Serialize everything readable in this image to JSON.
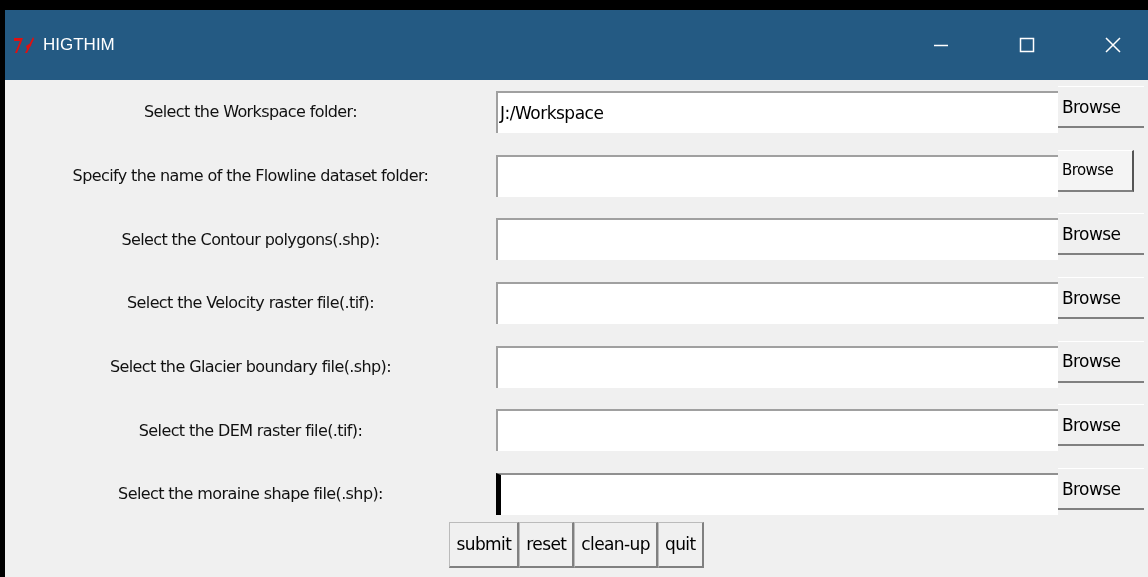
{
  "window": {
    "title": "HIGTHIM"
  },
  "rows": [
    {
      "label": "Select the Workspace folder:",
      "value": "J:/Workspace",
      "focused": false,
      "button": {
        "label": "Browse",
        "focused": false
      }
    },
    {
      "label": "Specify the name of the Flowline dataset folder:",
      "focused": false,
      "button": {
        "label": "Browse",
        "focused": true
      }
    },
    {
      "label": "Select the Contour polygons(.shp):",
      "focused": false,
      "button": {
        "label": "Browse",
        "focused": false
      }
    },
    {
      "label": "Select the Velocity raster file(.tif):",
      "focused": false,
      "button": {
        "label": "Browse",
        "focused": false
      }
    },
    {
      "label": "Select the Glacier boundary file(.shp):",
      "focused": false,
      "button": {
        "label": "Browse",
        "focused": false
      }
    },
    {
      "label": "Select the DEM raster file(.tif):",
      "focused": false,
      "button": {
        "label": "Browse",
        "focused": false
      }
    },
    {
      "label": "Select the moraine shape file(.shp):",
      "focused": true,
      "button": {
        "label": "Browse",
        "focused": false
      }
    }
  ],
  "buttons": [
    "submit",
    "reset",
    "clean-up",
    "quit"
  ]
}
